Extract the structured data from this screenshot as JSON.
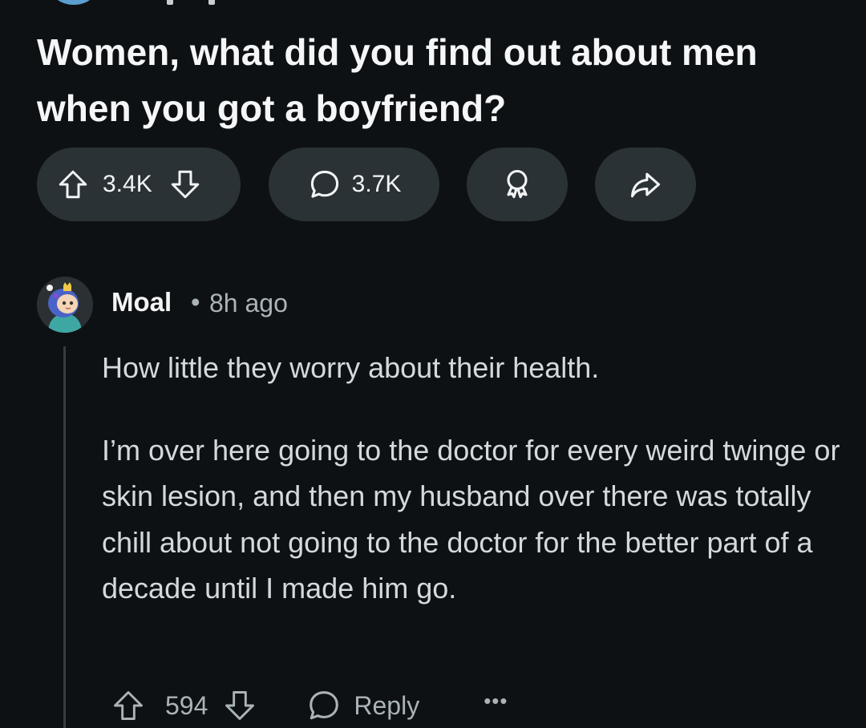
{
  "post": {
    "title": "Women, what did you find out about men when you got a boyfriend?",
    "vote_count": "3.4K",
    "comment_count": "3.7K"
  },
  "comment": {
    "username": "Moal",
    "separator": "•",
    "timestamp": "8h ago",
    "paragraphs": [
      "How little they worry about their health.",
      "I’m over here going to the doctor for every weird twinge or skin lesion, and then my husband over there was totally chill about not going to the doctor for the better part of a decade until I made him go."
    ],
    "vote_count": "594",
    "reply_label": "Reply",
    "more_label": "•••"
  },
  "icons": {
    "upvote": "upvote-arrow-icon",
    "downvote": "downvote-arrow-icon",
    "comments": "speech-bubble-icon",
    "award": "award-ribbon-icon",
    "share": "share-arrow-icon",
    "reply": "speech-bubble-icon",
    "more": "ellipsis-icon"
  },
  "colors": {
    "background": "#0e1113",
    "pill": "#2a3236",
    "text_primary": "#f2f4f5",
    "text_secondary": "#aab3b8",
    "thread_line": "#353d42"
  }
}
